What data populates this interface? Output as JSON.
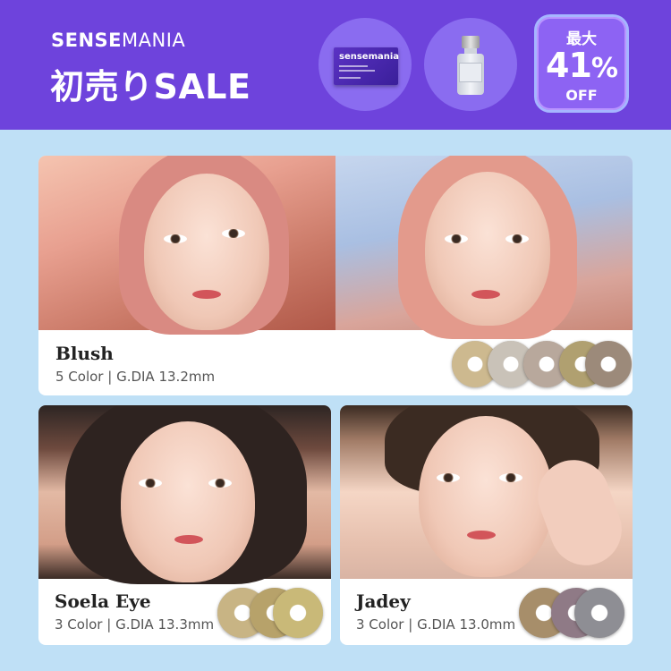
{
  "header": {
    "brand_bold": "SENSE",
    "brand_light": "MANIA",
    "sale_title": "初売りSALE",
    "package_logo": "sensemania",
    "badge": {
      "top": "最大",
      "number": "41",
      "percent": "%",
      "off": "OFF"
    },
    "colors": {
      "background": "#6e43dc",
      "circle": "#8a6cf0",
      "badge": "#8d63f3"
    }
  },
  "products": [
    {
      "name": "Blush",
      "spec": "5 Color | G.DIA 13.2mm",
      "lens_colors": [
        "#cdb98f",
        "#c9c2b8",
        "#b8a89c",
        "#b0a070",
        "#9c8a7a"
      ]
    },
    {
      "name": "Soela Eye",
      "spec": "3 Color | G.DIA 13.3mm",
      "lens_colors": [
        "#c8b484",
        "#b7a26a",
        "#c9b978"
      ]
    },
    {
      "name": "Jadey",
      "spec": "3 Color | G.DIA 13.0mm",
      "lens_colors": [
        "#a78e6a",
        "#8f7a86",
        "#8e8e94"
      ]
    }
  ]
}
